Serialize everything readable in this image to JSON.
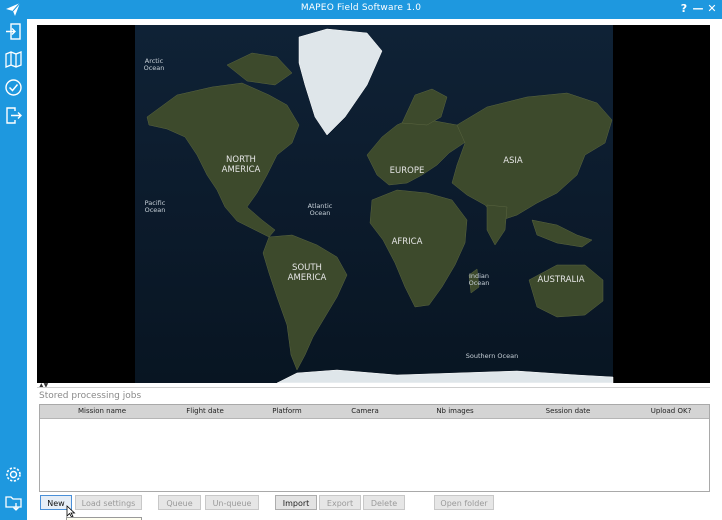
{
  "window": {
    "title": "MAPEO Field Software 1.0",
    "help_label": "?",
    "minimize_label": "—",
    "close_label": "✕",
    "accent_color": "#1e98df"
  },
  "sidebar": {
    "items": [
      {
        "name": "login-icon",
        "label": ""
      },
      {
        "name": "map-icon",
        "label": ""
      },
      {
        "name": "check-circle-icon",
        "label": ""
      },
      {
        "name": "logout-icon",
        "label": ""
      },
      {
        "name": "settings-gear-icon",
        "label": ""
      },
      {
        "name": "folder-download-icon",
        "label": ""
      }
    ]
  },
  "map": {
    "labels": [
      {
        "text": "Arctic\nOcean",
        "kind": "ocean"
      },
      {
        "text": "NORTH\nAMERICA",
        "kind": "continent"
      },
      {
        "text": "Pacific\nOcean",
        "kind": "ocean"
      },
      {
        "text": "Atlantic\nOcean",
        "kind": "ocean"
      },
      {
        "text": "EUROPE",
        "kind": "continent"
      },
      {
        "text": "ASIA",
        "kind": "continent"
      },
      {
        "text": "AFRICA",
        "kind": "continent"
      },
      {
        "text": "SOUTH\nAMERICA",
        "kind": "continent"
      },
      {
        "text": "Indian\nOcean",
        "kind": "ocean"
      },
      {
        "text": "AUSTRALIA",
        "kind": "continent"
      },
      {
        "text": "Southern Ocean",
        "kind": "ocean"
      }
    ]
  },
  "jobs": {
    "title": "Stored processing jobs",
    "columns": [
      "Mission name",
      "Flight date",
      "Platform",
      "Camera",
      "Nb images",
      "Session date",
      "Upload OK?"
    ],
    "rows": []
  },
  "buttons": {
    "new": "New",
    "load_settings": "Load settings",
    "queue": "Queue",
    "unqueue": "Un-queue",
    "import": "Import",
    "export": "Export",
    "delete": "Delete",
    "open_folder": "Open folder"
  }
}
